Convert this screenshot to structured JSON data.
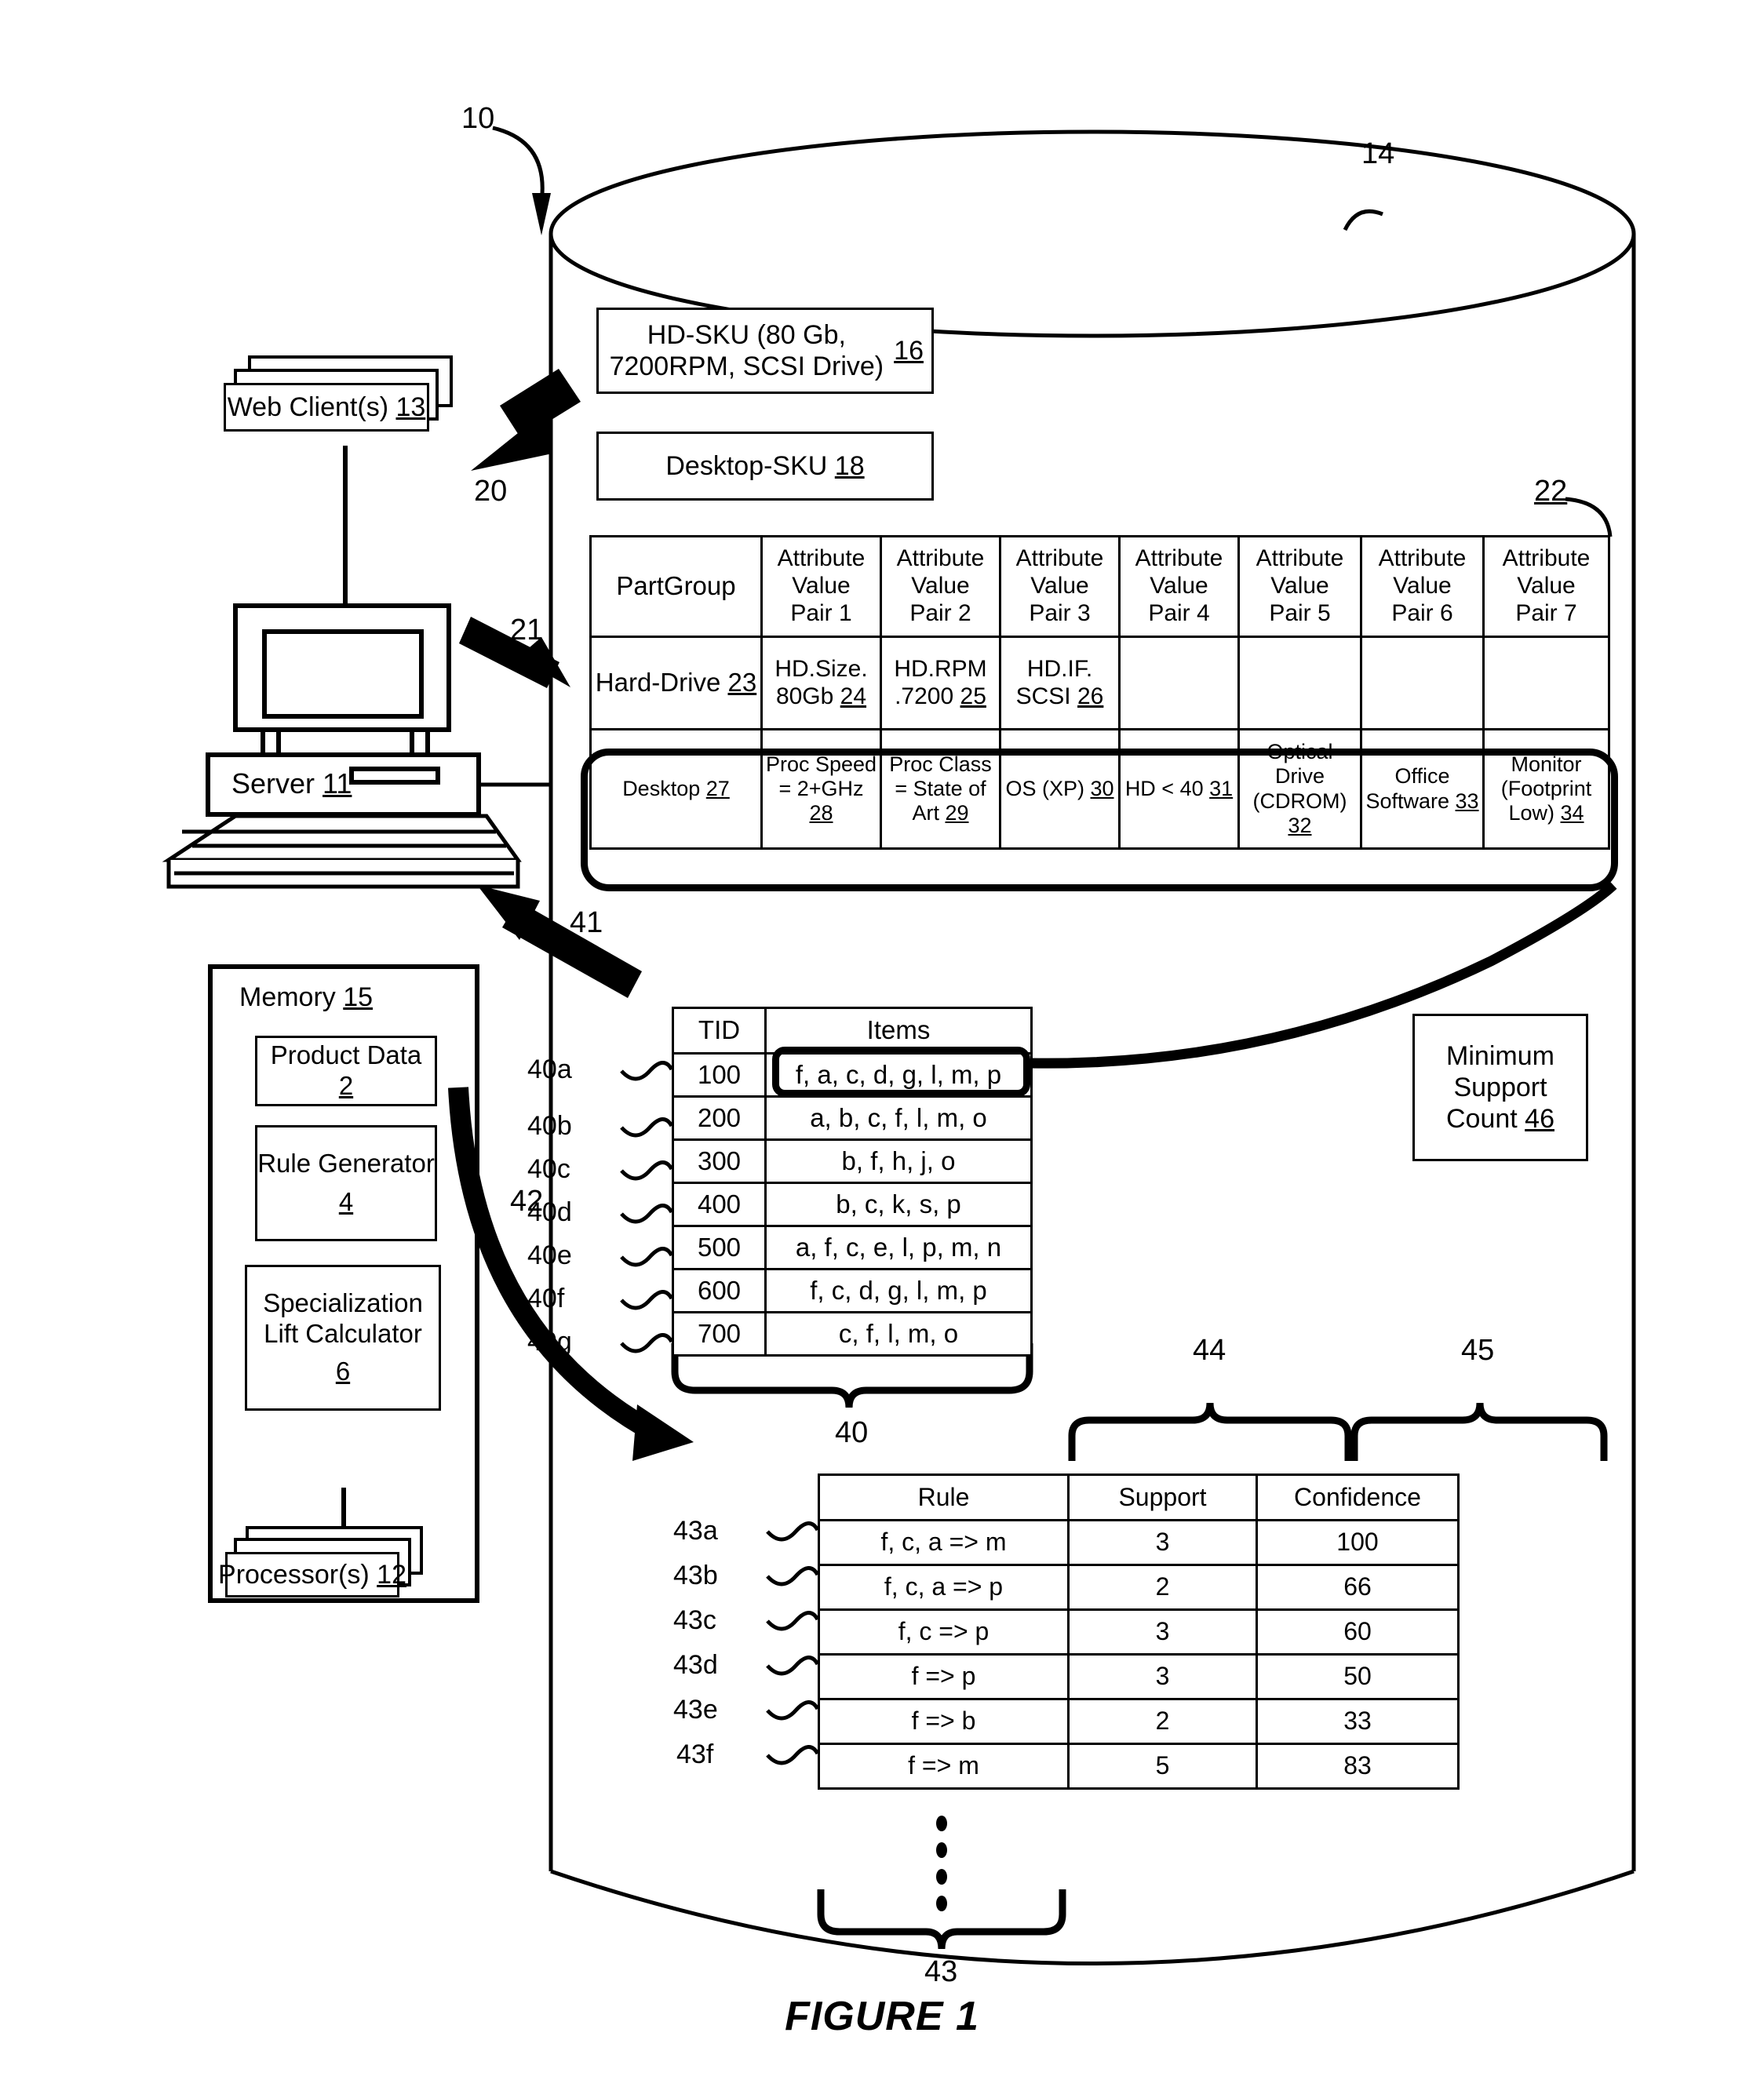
{
  "figure": {
    "caption": "FIGURE 1",
    "system_ref": "10",
    "database_ref": "14"
  },
  "clients": {
    "label": "Web Client(s)",
    "ref": "13"
  },
  "server": {
    "label": "Server",
    "ref": "11"
  },
  "memory": {
    "title": "Memory",
    "ref": "15",
    "modules": [
      {
        "label": "Product Data",
        "ref": "2"
      },
      {
        "label": "Rule Generator",
        "ref": "4"
      },
      {
        "label": "Specialization Lift Calculator",
        "ref": "6"
      }
    ]
  },
  "processor": {
    "label": "Processor(s)",
    "ref": "12"
  },
  "arrows": [
    {
      "ref": "20",
      "name": "client-to-db-arrow"
    },
    {
      "ref": "21",
      "name": "db-to-server-arrow"
    },
    {
      "ref": "41",
      "name": "transactions-to-server-arrow"
    },
    {
      "ref": "42",
      "name": "rule-generator-to-rules-arrow"
    }
  ],
  "sku_boxes": [
    {
      "text": "HD-SKU (80 Gb, 7200RPM, SCSI Drive)",
      "ref": "16"
    },
    {
      "text": "Desktop-SKU",
      "ref": "18"
    }
  ],
  "attribute_table": {
    "ref": "22",
    "headers": [
      "PartGroup",
      "Attribute Value Pair 1",
      "Attribute Value Pair 2",
      "Attribute Value Pair 3",
      "Attribute Value Pair 4",
      "Attribute Value Pair 5",
      "Attribute Value Pair 6",
      "Attribute Value Pair 7"
    ],
    "header_lines": [
      [
        "PartGroup"
      ],
      [
        "Attribute",
        "Value",
        "Pair 1"
      ],
      [
        "Attribute",
        "Value",
        "Pair 2"
      ],
      [
        "Attribute",
        "Value",
        "Pair 3"
      ],
      [
        "Attribute",
        "Value",
        "Pair 4"
      ],
      [
        "Attribute",
        "Value",
        "Pair 5"
      ],
      [
        "Attribute",
        "Value",
        "Pair 6"
      ],
      [
        "Attribute",
        "Value",
        "Pair 7"
      ]
    ],
    "rows": [
      {
        "name": "hard-drive-row",
        "partgroup": {
          "text": "Hard-Drive",
          "ref": "23"
        },
        "cells": [
          {
            "text": "HD.Size. 80Gb",
            "ref": "24"
          },
          {
            "text": "HD.RPM .7200",
            "ref": "25"
          },
          {
            "text": "HD.IF. SCSI",
            "ref": "26"
          },
          {
            "text": "",
            "ref": ""
          },
          {
            "text": "",
            "ref": ""
          },
          {
            "text": "",
            "ref": ""
          },
          {
            "text": "",
            "ref": ""
          }
        ]
      },
      {
        "name": "desktop-row",
        "highlighted": true,
        "partgroup": {
          "text": "Desktop",
          "ref": "27"
        },
        "cells": [
          {
            "text": "Proc Speed = 2+GHz",
            "ref": "28"
          },
          {
            "text": "Proc Class = State of Art",
            "ref": "29"
          },
          {
            "text": "OS (XP)",
            "ref": "30"
          },
          {
            "text": "HD < 40",
            "ref": "31"
          },
          {
            "text": "Optical Drive (CDROM)",
            "ref": "32"
          },
          {
            "text": "Office Software",
            "ref": "33"
          },
          {
            "text": "Monitor (Footprint Low)",
            "ref": "34"
          }
        ]
      }
    ]
  },
  "transaction_table": {
    "ref": "40",
    "headers": [
      "TID",
      "Items"
    ],
    "rows": [
      {
        "ref": "40a",
        "tid": "100",
        "items": "f, a, c, d, g, l, m, p",
        "highlighted": true
      },
      {
        "ref": "40b",
        "tid": "200",
        "items": "a, b, c, f, l, m, o",
        "highlighted": false
      },
      {
        "ref": "40c",
        "tid": "300",
        "items": "b, f, h, j, o",
        "highlighted": false
      },
      {
        "ref": "40d",
        "tid": "400",
        "items": "b, c, k, s, p",
        "highlighted": false
      },
      {
        "ref": "40e",
        "tid": "500",
        "items": "a, f, c, e, l, p, m, n",
        "highlighted": false
      },
      {
        "ref": "40f",
        "tid": "600",
        "items": "f, c, d, g, l, m, p",
        "highlighted": false
      },
      {
        "ref": "40g",
        "tid": "700",
        "items": "c, f, l, m, o",
        "highlighted": false
      }
    ]
  },
  "min_support_box": {
    "lines": [
      "Minimum",
      "Support",
      "Count"
    ],
    "ref": "46"
  },
  "rules_table": {
    "ref": "43",
    "support_brace_ref": "44",
    "confidence_brace_ref": "45",
    "headers": [
      "Rule",
      "Support",
      "Confidence"
    ],
    "rows": [
      {
        "ref": "43a",
        "rule": "f, c, a  => m",
        "support": "3",
        "confidence": "100"
      },
      {
        "ref": "43b",
        "rule": "f, c, a  => p",
        "support": "2",
        "confidence": "66"
      },
      {
        "ref": "43c",
        "rule": "f, c   => p",
        "support": "3",
        "confidence": "60"
      },
      {
        "ref": "43d",
        "rule": "f  => p",
        "support": "3",
        "confidence": "50"
      },
      {
        "ref": "43e",
        "rule": "f  => b",
        "support": "2",
        "confidence": "33"
      },
      {
        "ref": "43f",
        "rule": "f  => m",
        "support": "5",
        "confidence": "83"
      }
    ]
  }
}
